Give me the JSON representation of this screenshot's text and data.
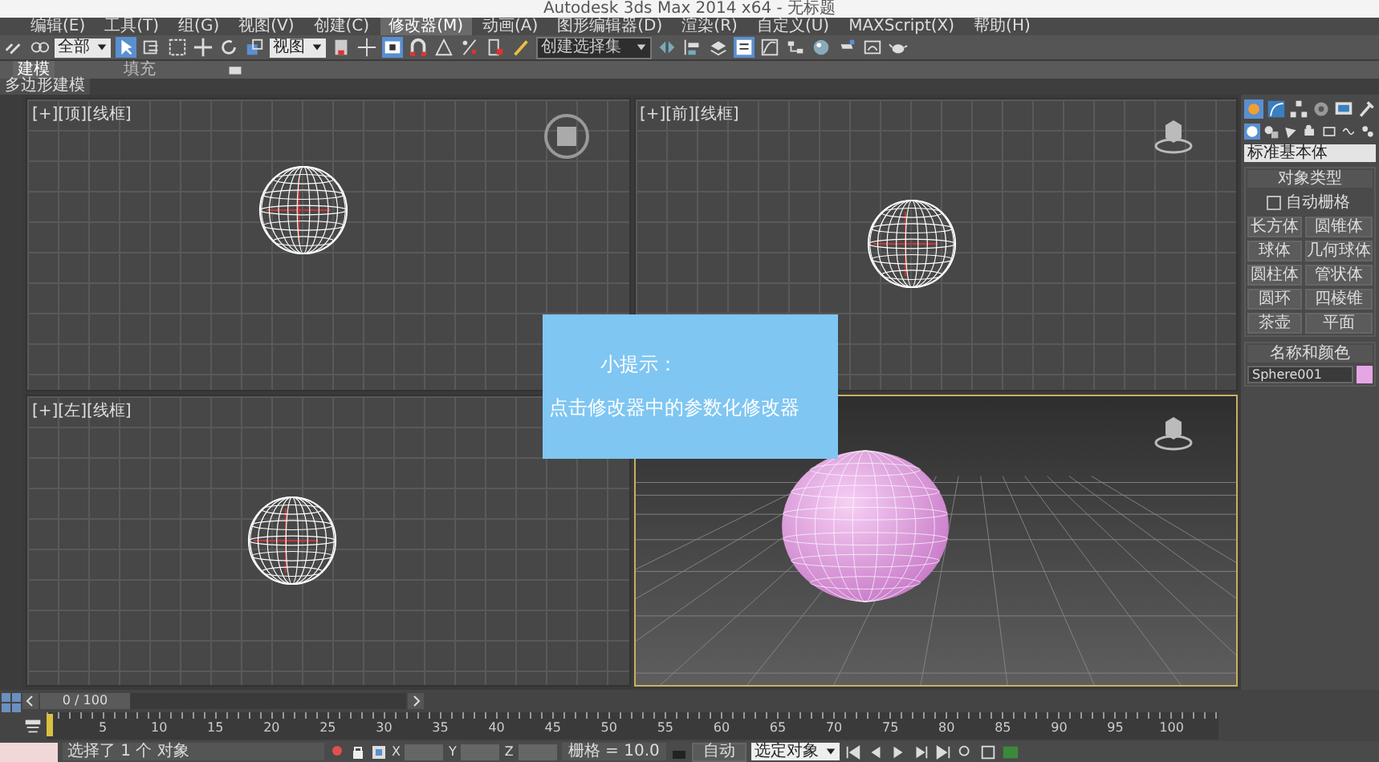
{
  "window": {
    "title": "Autodesk 3ds Max 2014 x64 - 无标题"
  },
  "menu": [
    {
      "label": "编辑(E)",
      "selected": false
    },
    {
      "label": "工具(T)",
      "selected": false
    },
    {
      "label": "组(G)",
      "selected": false
    },
    {
      "label": "视图(V)",
      "selected": false
    },
    {
      "label": "创建(C)",
      "selected": false
    },
    {
      "label": "修改器(M)",
      "selected": true
    },
    {
      "label": "动画(A)",
      "selected": false
    },
    {
      "label": "图形编辑器(D)",
      "selected": false
    },
    {
      "label": "渲染(R)",
      "selected": false
    },
    {
      "label": "自定义(U)",
      "selected": false
    },
    {
      "label": "MAXScript(X)",
      "selected": false
    },
    {
      "label": "帮助(H)",
      "selected": false
    }
  ],
  "toolbar": {
    "selection_filter": "全部",
    "reference_coord": "视图",
    "selection_set": "创建选择集"
  },
  "ribbon": {
    "tabs": [
      {
        "label": "建模",
        "selected": true
      },
      {
        "label": "填充",
        "selected": false
      }
    ],
    "panel_label": "多边形建模"
  },
  "viewports": [
    {
      "label": "[+][顶][线框]",
      "kind": "wire",
      "active": false
    },
    {
      "label": "[+][前][线框]",
      "kind": "wire",
      "active": false
    },
    {
      "label": "[+][左][线框]",
      "kind": "wire",
      "active": false
    },
    {
      "kind": "shaded",
      "active": true
    }
  ],
  "tooltip": {
    "title": "小提示：",
    "text": "点击修改器中的参数化修改器"
  },
  "command_panel": {
    "category": "标准基本体",
    "object_type": {
      "title": "对象类型",
      "autogrid": {
        "label": "自动栅格",
        "checked": false
      },
      "buttons": [
        "长方体",
        "圆锥体",
        "球体",
        "几何球体",
        "圆柱体",
        "管状体",
        "圆环",
        "四棱锥",
        "茶壶",
        "平面"
      ]
    },
    "name_color": {
      "title": "名称和颜色",
      "name": "Sphere001",
      "color": "#e6a6e6"
    }
  },
  "timeline": {
    "frame": "0 / 100",
    "level": 0,
    "ticks": [
      "5",
      "10",
      "15",
      "20",
      "25",
      "30",
      "35",
      "40",
      "45",
      "50",
      "55",
      "60",
      "65",
      "70",
      "75",
      "80",
      "85",
      "90",
      "95",
      "100"
    ]
  },
  "status": {
    "message": "选择了 1 个 对象",
    "coords": [
      "X",
      "Y",
      "Z"
    ],
    "grid": "栅格 = 10.0",
    "auto_key": "自动",
    "key_filter": "选定对象"
  }
}
